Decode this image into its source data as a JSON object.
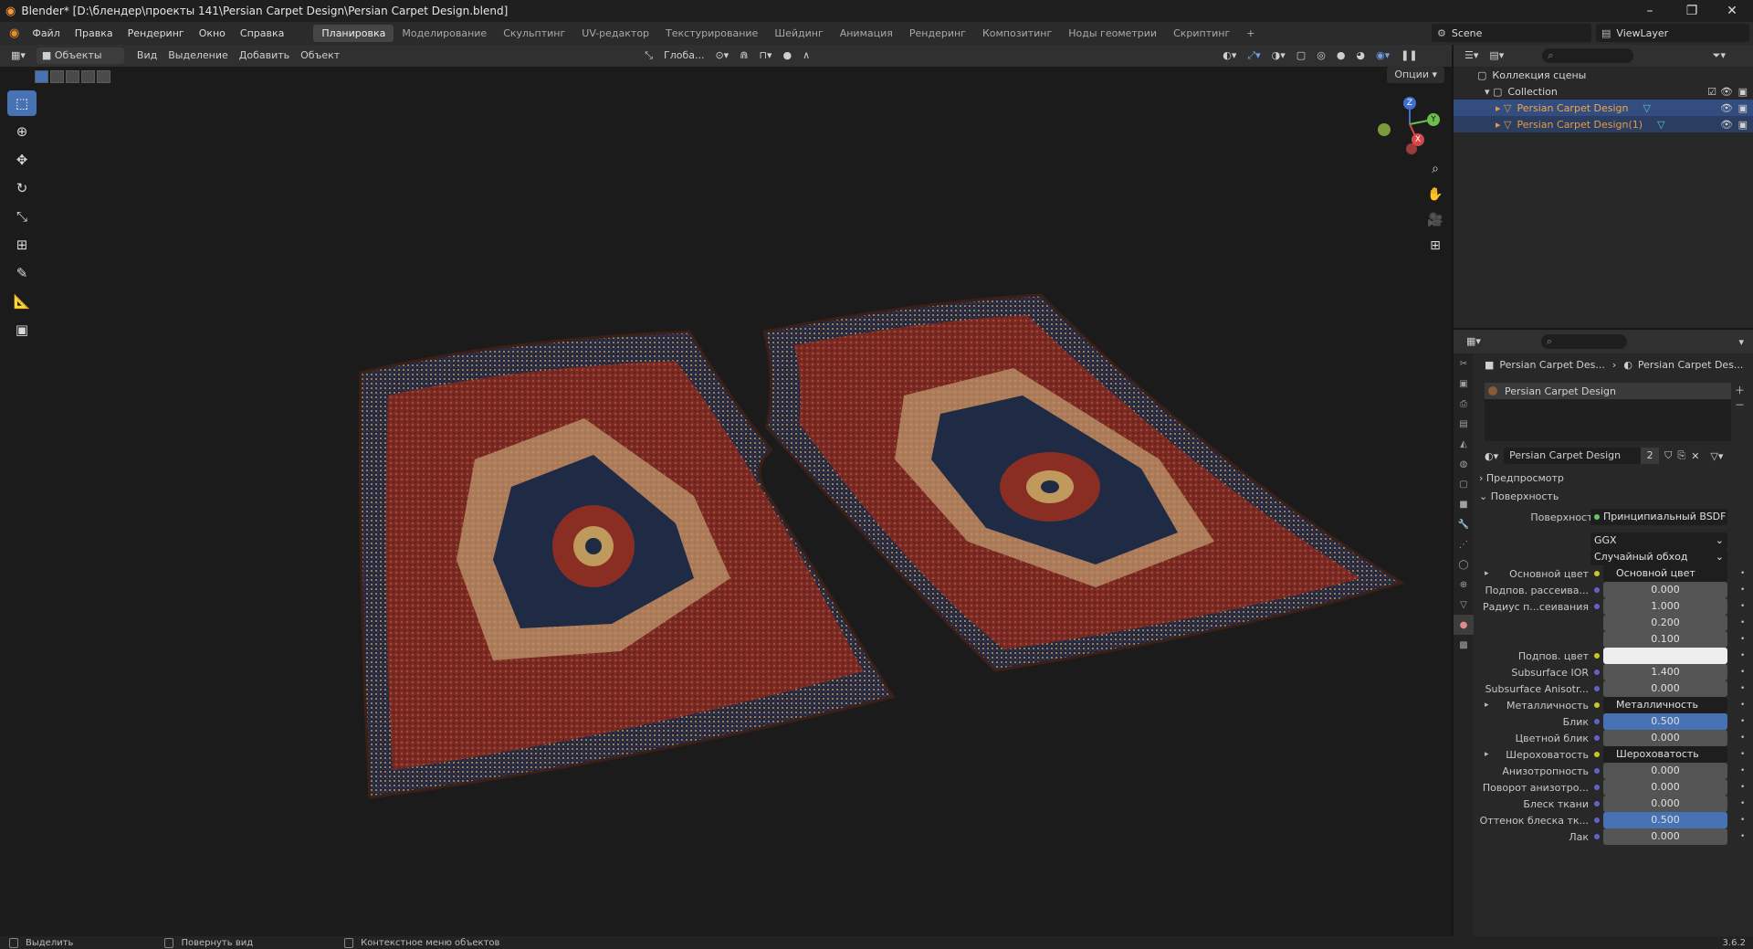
{
  "window": {
    "title": "Blender* [D:\\блендер\\проекты 141\\Persian Carpet Design\\Persian Carpet Design.blend]",
    "controls": {
      "minimize": "–",
      "restore": "❐",
      "close": "✕"
    }
  },
  "menu": {
    "items": [
      "Файл",
      "Правка",
      "Рендеринг",
      "Окно",
      "Справка"
    ],
    "workspaces": [
      "Планировка",
      "Моделирование",
      "Скульптинг",
      "UV-редактор",
      "Текстурирование",
      "Шейдинг",
      "Анимация",
      "Рендеринг",
      "Композитинг",
      "Ноды геометрии",
      "Скриптинг"
    ],
    "active_workspace": "Планировка",
    "add_tab": "+",
    "scene": "Scene",
    "view_layer": "ViewLayer"
  },
  "viewport_header": {
    "mode": "Объекты",
    "menus": [
      "Вид",
      "Выделение",
      "Добавить",
      "Объект"
    ],
    "transform_orientation": "Глоба...",
    "options": "Опции"
  },
  "toolbar": {
    "tools": [
      "select-box",
      "cursor",
      "move",
      "rotate",
      "scale",
      "transform",
      "annotate",
      "measure",
      "add-cube"
    ]
  },
  "gizmo": {
    "z": "Z",
    "y": "Y",
    "x": "X"
  },
  "outliner": {
    "scene_collection": "Коллекция сцены",
    "collection": "Collection",
    "objects": [
      "Persian Carpet Design",
      "Persian Carpet Design(1)"
    ]
  },
  "properties": {
    "breadcrumb_object": "Persian Carpet Des...",
    "breadcrumb_material": "Persian Carpet Des...",
    "slot": "Persian Carpet Design",
    "material_name": "Persian Carpet Design",
    "user_count": "2",
    "sections": {
      "preview": "Предпросмотр",
      "surface": "Поверхность"
    },
    "surface_label": "Поверхность",
    "surface_shader": "Принципиальный BSDF",
    "distribution": "GGX",
    "subsurface_method": "Случайный обход",
    "rows": [
      {
        "label": "Основной цвет",
        "value": "Основной цвет",
        "kind": "link",
        "expand": true
      },
      {
        "label": "Подпов. рассеива...",
        "value": "0.000",
        "kind": "num"
      },
      {
        "label": "Радиус п...сеивания",
        "value": "1.000",
        "kind": "num"
      },
      {
        "label": "",
        "value": "0.200",
        "kind": "num"
      },
      {
        "label": "",
        "value": "0.100",
        "kind": "num"
      },
      {
        "label": "Подпов. цвет",
        "value": "",
        "kind": "color"
      },
      {
        "label": "Subsurface IOR",
        "value": "1.400",
        "kind": "num"
      },
      {
        "label": "Subsurface Anisotr...",
        "value": "0.000",
        "kind": "num"
      },
      {
        "label": "Металличность",
        "value": "Металличность",
        "kind": "link",
        "expand": true
      },
      {
        "label": "Блик",
        "value": "0.500",
        "kind": "slider"
      },
      {
        "label": "Цветной блик",
        "value": "0.000",
        "kind": "num"
      },
      {
        "label": "Шероховатость",
        "value": "Шероховатость",
        "kind": "link",
        "expand": true
      },
      {
        "label": "Анизотропность",
        "value": "0.000",
        "kind": "num"
      },
      {
        "label": "Поворот анизотро...",
        "value": "0.000",
        "kind": "num"
      },
      {
        "label": "Блеск ткани",
        "value": "0.000",
        "kind": "num"
      },
      {
        "label": "Оттенок блеска тк...",
        "value": "0.500",
        "kind": "slider"
      },
      {
        "label": "Лак",
        "value": "0.000",
        "kind": "num"
      }
    ]
  },
  "statusbar": {
    "select": "Выделить",
    "rotate": "Повернуть вид",
    "context": "Контекстное меню объектов",
    "version": "3.6.2"
  },
  "colors": {
    "accent": "#4772b3",
    "carpet_red": "#8a2a22",
    "carpet_navy": "#1e2740",
    "carpet_gold": "#b89a5a"
  }
}
